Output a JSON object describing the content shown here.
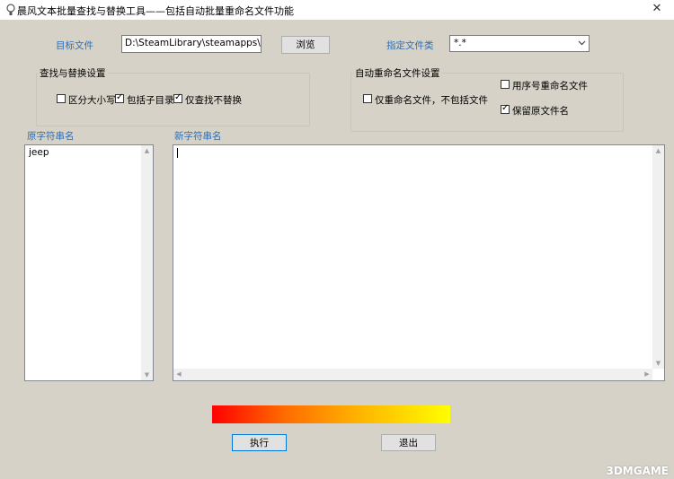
{
  "window": {
    "title": "晨风文本批量查找与替换工具——包括自动批量重命名文件功能",
    "close_glyph": "✕"
  },
  "target": {
    "label": "目标文件",
    "path_value": "D:\\SteamLibrary\\steamapps\\commo",
    "browse_label": "浏览"
  },
  "filetype": {
    "label": "指定文件类",
    "selected": "*.*"
  },
  "search_settings": {
    "title": "查找与替换设置",
    "options": [
      {
        "label": "区分大小写",
        "checked": false
      },
      {
        "label": "包括子目录",
        "checked": true
      },
      {
        "label": "仅查找不替换",
        "checked": true
      }
    ]
  },
  "rename_settings": {
    "title": "自动重命名文件设置",
    "rename_only": {
      "label": "仅重命名文件，不包括文件内容",
      "checked": false
    },
    "use_serial": {
      "label": "用序号重命名文件",
      "checked": false
    },
    "keep_original": {
      "label": "保留原文件名",
      "checked": true
    }
  },
  "original_strings": {
    "label": "原字符串名",
    "items": [
      "jeep"
    ]
  },
  "new_strings": {
    "label": "新字符串名",
    "content": ""
  },
  "progress": {
    "value": 1.0
  },
  "actions": {
    "execute_label": "执行",
    "exit_label": "退出"
  },
  "watermark": "3DMGAME"
}
